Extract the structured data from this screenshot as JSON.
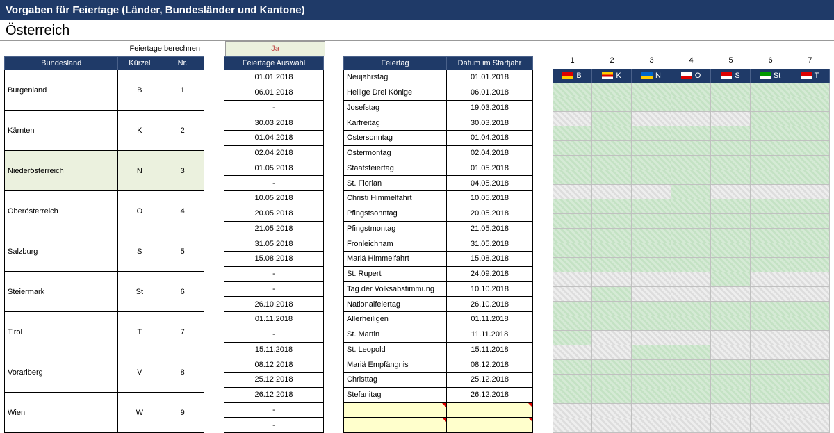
{
  "title": "Vorgaben für Feiertage  (Länder, Bundesländer und Kantone)",
  "subtitle": "Österreich",
  "calc_label": "Feiertage berechnen ein? =>",
  "calc_value": "Ja",
  "bund_headers": [
    "Bundesland",
    "Kürzel",
    "Nr."
  ],
  "bund_rows": [
    {
      "name": "Burgenland",
      "k": "B",
      "n": "1"
    },
    {
      "name": "Kärnten",
      "k": "K",
      "n": "2"
    },
    {
      "name": "Niederösterreich",
      "k": "N",
      "n": "3",
      "hl": true
    },
    {
      "name": "Oberösterreich",
      "k": "O",
      "n": "4"
    },
    {
      "name": "Salzburg",
      "k": "S",
      "n": "5"
    },
    {
      "name": "Steiermark",
      "k": "St",
      "n": "6"
    },
    {
      "name": "Tirol",
      "k": "T",
      "n": "7"
    },
    {
      "name": "Vorarlberg",
      "k": "V",
      "n": "8"
    },
    {
      "name": "Wien",
      "k": "W",
      "n": "9"
    }
  ],
  "auswahl_header": "Feiertage Auswahl",
  "auswahl": [
    "01.01.2018",
    "06.01.2018",
    "-",
    "30.03.2018",
    "01.04.2018",
    "02.04.2018",
    "01.05.2018",
    "-",
    "10.05.2018",
    "20.05.2018",
    "21.05.2018",
    "31.05.2018",
    "15.08.2018",
    "-",
    "-",
    "26.10.2018",
    "01.11.2018",
    "-",
    "15.11.2018",
    "08.12.2018",
    "25.12.2018",
    "26.12.2018",
    "-",
    "-"
  ],
  "feiertag_headers": [
    "Feiertag",
    "Datum im Startjahr"
  ],
  "feiertage": [
    {
      "n": "Neujahrstag",
      "d": "01.01.2018"
    },
    {
      "n": "Heilige Drei Könige",
      "d": "06.01.2018"
    },
    {
      "n": "Josefstag",
      "d": "19.03.2018"
    },
    {
      "n": "Karfreitag",
      "d": "30.03.2018"
    },
    {
      "n": "Ostersonntag",
      "d": "01.04.2018"
    },
    {
      "n": "Ostermontag",
      "d": "02.04.2018"
    },
    {
      "n": "Staatsfeiertag",
      "d": "01.05.2018"
    },
    {
      "n": "St. Florian",
      "d": "04.05.2018"
    },
    {
      "n": "Christi Himmelfahrt",
      "d": "10.05.2018"
    },
    {
      "n": "Pfingstsonntag",
      "d": "20.05.2018"
    },
    {
      "n": "Pfingstmontag",
      "d": "21.05.2018"
    },
    {
      "n": "Fronleichnam",
      "d": "31.05.2018"
    },
    {
      "n": "Mariä Himmelfahrt",
      "d": "15.08.2018"
    },
    {
      "n": "St. Rupert",
      "d": "24.09.2018"
    },
    {
      "n": "Tag der Volksabstimmung",
      "d": "10.10.2018"
    },
    {
      "n": "Nationalfeiertag",
      "d": "26.10.2018"
    },
    {
      "n": "Allerheiligen",
      "d": "01.11.2018"
    },
    {
      "n": "St. Martin",
      "d": "11.11.2018"
    },
    {
      "n": "St. Leopold",
      "d": "15.11.2018"
    },
    {
      "n": "Mariä Empfängnis",
      "d": "08.12.2018"
    },
    {
      "n": "Christtag",
      "d": "25.12.2018"
    },
    {
      "n": "Stefanitag",
      "d": "26.12.2018"
    },
    {
      "n": "",
      "d": "",
      "empty": true
    },
    {
      "n": "",
      "d": "",
      "empty": true
    }
  ],
  "grid_cols": [
    "1",
    "2",
    "3",
    "4",
    "5",
    "6",
    "7"
  ],
  "grid_flags": [
    {
      "k": "B",
      "c": [
        "#d00",
        "#fc0"
      ]
    },
    {
      "k": "K",
      "c": [
        "#fc0",
        "#d00",
        "#fff"
      ]
    },
    {
      "k": "N",
      "c": [
        "#06c",
        "#fc0"
      ]
    },
    {
      "k": "O",
      "c": [
        "#fff",
        "#d00"
      ]
    },
    {
      "k": "S",
      "c": [
        "#d00",
        "#fff"
      ]
    },
    {
      "k": "St",
      "c": [
        "#090",
        "#fff"
      ]
    },
    {
      "k": "T",
      "c": [
        "#d00",
        "#fff"
      ]
    }
  ],
  "grid_rows": [
    "ggggggg",
    "ggggggg",
    "xgxxxgg",
    "ggggggg",
    "ggggggg",
    "ggggggg",
    "ggggggg",
    "xxxgxxx",
    "ggggggg",
    "ggggggg",
    "ggggggg",
    "ggggggg",
    "ggggggg",
    "xxxxgxx",
    "xgxxxxx",
    "ggggggg",
    "ggggggg",
    "gxxxxxx",
    "xxggxxx",
    "ggggggg",
    "ggggggg",
    "ggggggg",
    "xxxxxxx",
    "xxxxxxx"
  ]
}
